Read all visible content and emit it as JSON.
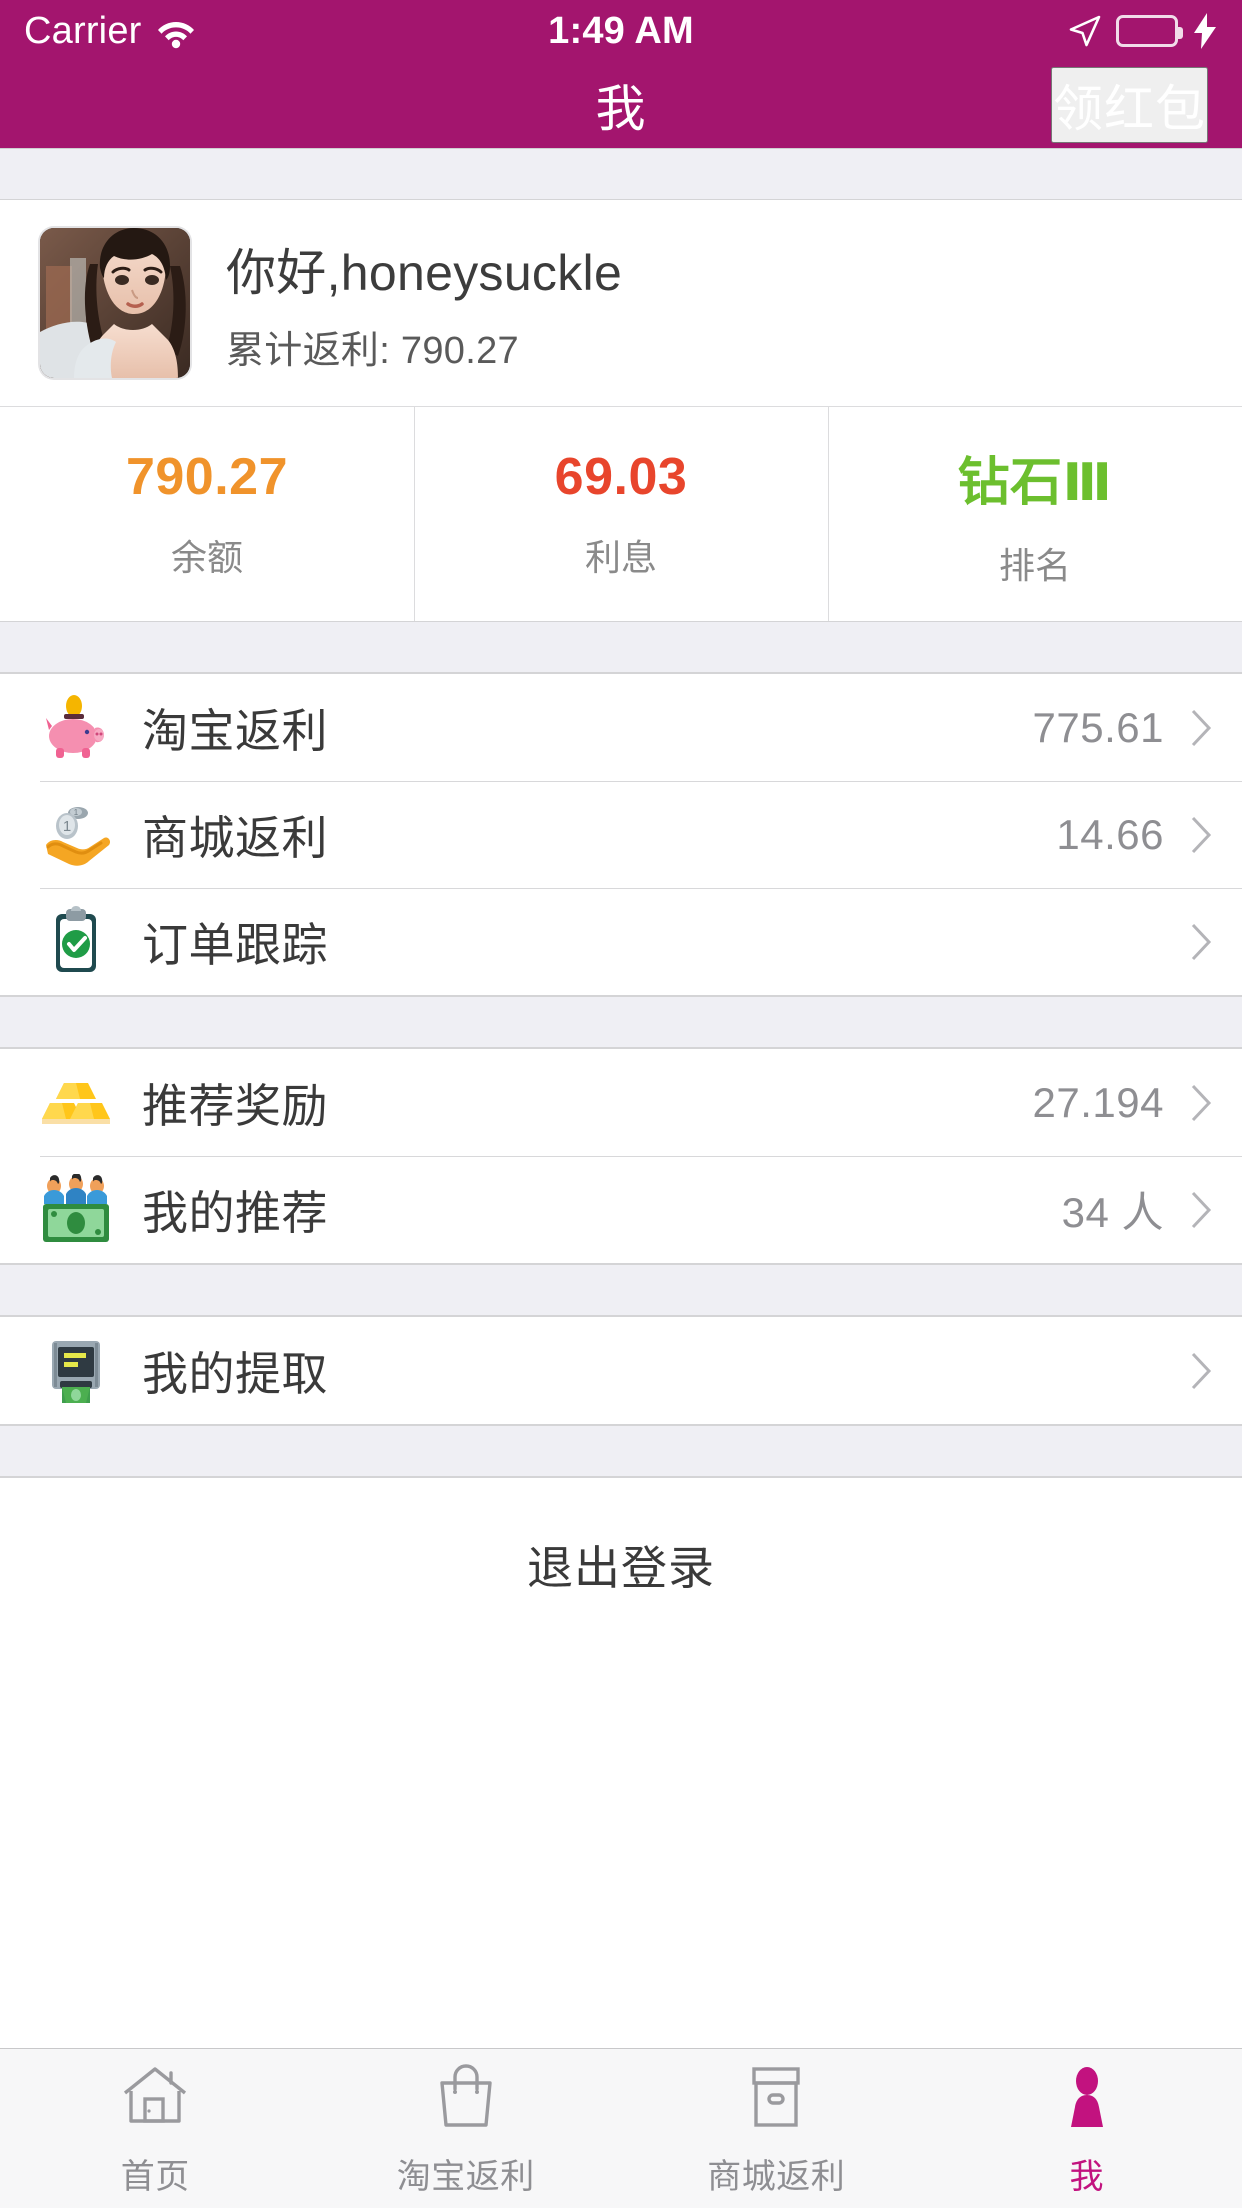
{
  "theme": {
    "header_bg": "#a3156e",
    "accent": "#c2127f",
    "balance_color": "#f0932b",
    "interest_color": "#e8452c",
    "rank_color": "#6cbf2e",
    "page_bg": "#efeff4",
    "card_bg": "#ffffff",
    "muted_text": "#8e8e92"
  },
  "statusbar": {
    "carrier": "Carrier",
    "wifi_icon": "wifi-icon",
    "time": "1:49 AM",
    "location_icon": "location-arrow-icon",
    "battery_icon": "battery-full-icon",
    "battery_level": 100,
    "charging_icon": "lightning-bolt-icon"
  },
  "navbar": {
    "title": "我",
    "action_label": "领红包"
  },
  "profile": {
    "avatar_icon": "user-avatar-photo",
    "greeting": "你好,honeysuckle",
    "rebate_label": "累计返利: 790.27"
  },
  "stats": [
    {
      "value": "790.27",
      "label": "余额",
      "color": "#f0932b"
    },
    {
      "value": "69.03",
      "label": "利息",
      "color": "#e8452c"
    },
    {
      "value": "钻石Ⅲ",
      "label": "排名",
      "color": "#6cbf2e"
    }
  ],
  "groups": [
    {
      "rows": [
        {
          "icon": "piggy-bank-icon",
          "label": "淘宝返利",
          "value": "775.61"
        },
        {
          "icon": "coin-in-hand-icon",
          "label": "商城返利",
          "value": "14.66"
        },
        {
          "icon": "clipboard-check-icon",
          "label": "订单跟踪",
          "value": ""
        }
      ]
    },
    {
      "rows": [
        {
          "icon": "gold-bars-icon",
          "label": "推荐奖励",
          "value": "27.194"
        },
        {
          "icon": "people-money-icon",
          "label": "我的推荐",
          "value": "34 人"
        }
      ]
    },
    {
      "rows": [
        {
          "icon": "atm-machine-icon",
          "label": "我的提取",
          "value": ""
        }
      ]
    }
  ],
  "logout": {
    "label": "退出登录"
  },
  "tabbar": {
    "tabs": [
      {
        "icon": "home-icon",
        "label": "首页",
        "active": false
      },
      {
        "icon": "shopping-bag-icon",
        "label": "淘宝返利",
        "active": false
      },
      {
        "icon": "store-box-icon",
        "label": "商城返利",
        "active": false
      },
      {
        "icon": "person-icon",
        "label": "我",
        "active": true
      }
    ]
  }
}
